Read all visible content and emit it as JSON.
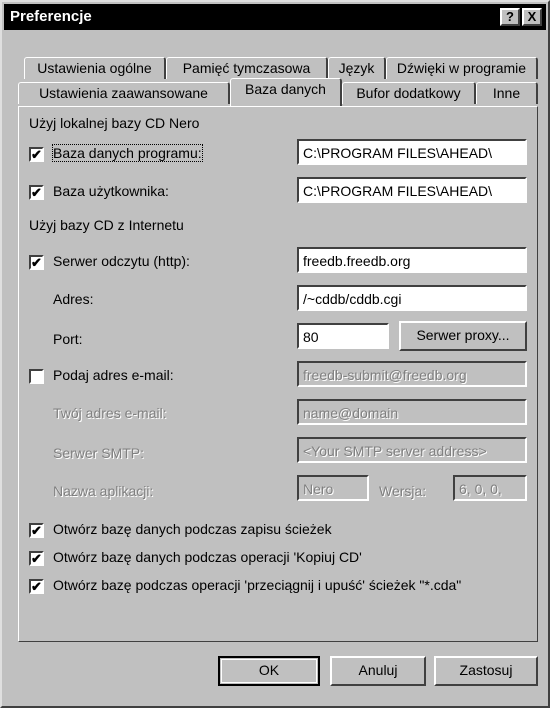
{
  "window": {
    "title": "Preferencje",
    "help_button": "?",
    "close_button": "X"
  },
  "tabs_row1": [
    "Ustawienia ogólne",
    "Pamięć tymczasowa",
    "Język",
    "Dźwięki w programie"
  ],
  "tabs_row2": [
    "Ustawienia zaawansowane",
    "Baza danych",
    "Bufor dodatkowy",
    "Inne"
  ],
  "active_tab": "Baza danych",
  "local_section": {
    "header": "Użyj lokalnej bazy CD Nero",
    "program_db": {
      "label": "Baza danych programu:",
      "checked": true,
      "value": "C:\\PROGRAM FILES\\AHEAD\\"
    },
    "user_db": {
      "label": "Baza użytkownika:",
      "checked": true,
      "value": "C:\\PROGRAM FILES\\AHEAD\\"
    }
  },
  "internet_section": {
    "header": "Użyj bazy CD z Internetu",
    "server": {
      "label": "Serwer odczytu (http):",
      "checked": true,
      "value": "freedb.freedb.org"
    },
    "address": {
      "label": "Adres:",
      "value": "/~cddb/cddb.cgi"
    },
    "port": {
      "label": "Port:",
      "value": "80"
    },
    "proxy_button": "Serwer proxy...",
    "email": {
      "label": "Podaj adres e-mail:",
      "checked": false,
      "value": "freedb-submit@freedb.org"
    },
    "your_email": {
      "label": "Twój adres e-mail:",
      "value": "name@domain"
    },
    "smtp": {
      "label": "Serwer SMTP:",
      "value": "<Your SMTP server address>"
    },
    "app_name": {
      "label": "Nazwa aplikacji:",
      "value": "Nero"
    },
    "version": {
      "label": "Wersja:",
      "value": "6, 0, 0,"
    }
  },
  "options": [
    {
      "label": "Otwórz bazę danych podczas zapisu ścieżek",
      "checked": true
    },
    {
      "label": "Otwórz bazę danych podczas operacji 'Kopiuj CD'",
      "checked": true
    },
    {
      "label": "Otwórz bazę podczas operacji 'przeciągnij i upuść' ścieżek \"*.cda\"",
      "checked": true
    }
  ],
  "footer": {
    "ok": "OK",
    "cancel": "Anuluj",
    "apply": "Zastosuj"
  },
  "check_glyph": "✔"
}
